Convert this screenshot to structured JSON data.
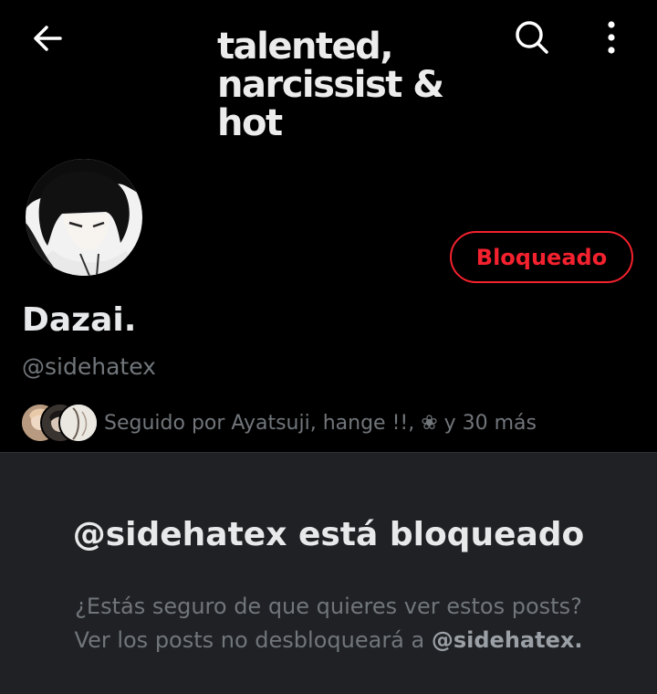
{
  "header": {
    "banner_lines": [
      "talented,",
      "narcissist &",
      "hot"
    ],
    "back_icon": "arrow-left-icon",
    "search_icon": "search-icon",
    "more_icon": "more-vertical-icon"
  },
  "profile": {
    "display_name": "Dazai.",
    "handle": "@sidehatex",
    "block_button_label": "Bloqueado",
    "followed_by_text": "Seguido por Ayatsuji, hange !!, ❀ y 30 más"
  },
  "blocked_notice": {
    "title": "@sidehatex está bloqueado",
    "line1": "¿Estás seguro de que quieres ver estos posts?",
    "line2_prefix": "Ver los posts no desbloqueará a ",
    "line2_handle": "@sidehatex."
  },
  "colors": {
    "accent_red": "#f4212e",
    "muted_text": "#71767b",
    "panel_bg": "#1f2124"
  }
}
